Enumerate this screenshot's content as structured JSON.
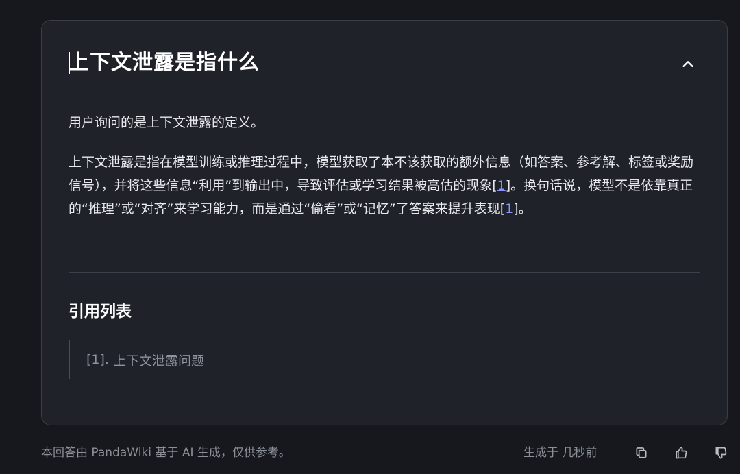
{
  "answer": {
    "title": "上下文泄露是指什么",
    "paragraph1": "用户询问的是上下文泄露的定义。",
    "paragraph2_part1": "上下文泄露是指在模型训练或推理过程中，模型获取了本不该获取的额外信息（如答案、参考解、标签或奖励信号），并将这些信息“利用”到输出中，导致评估或学习结果被高估的现象",
    "paragraph2_part2": "。换句话说，模型不是依靠真正的“推理”或“对齐”来学习能力，而是通过“偷看”或“记忆”了答案来提升表现",
    "paragraph2_end": "。",
    "citation_number": "1"
  },
  "references": {
    "heading": "引用列表",
    "items": [
      {
        "index": "[1].",
        "label": "上下文泄露问题"
      }
    ]
  },
  "footer": {
    "disclaimer": "本回答由 PandaWiki 基于 AI 生成，仅供参考。",
    "generated_time": "生成于 几秒前",
    "icons": [
      "copy-icon",
      "thumbs-up-icon",
      "thumbs-down-icon"
    ]
  },
  "colors": {
    "background": "#16181e",
    "card": "#1f2229",
    "citation_link": "#8a94ff"
  }
}
